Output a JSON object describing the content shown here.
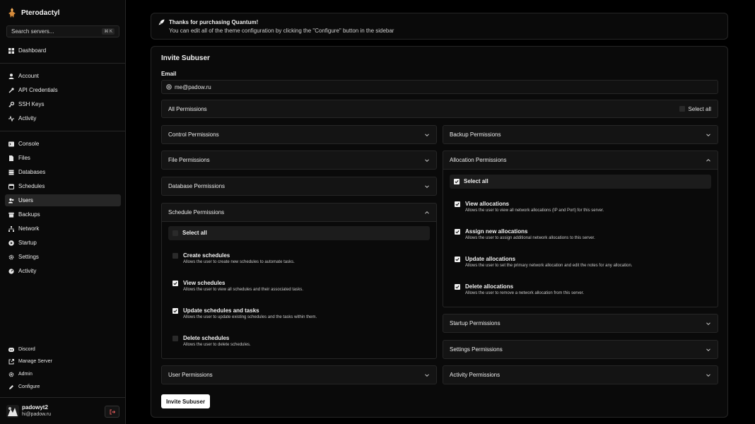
{
  "app": {
    "name": "Pterodactyl"
  },
  "search": {
    "placeholder": "Search servers...",
    "shortcut": "⌘ K"
  },
  "nav": {
    "dashboard": "Dashboard",
    "account": "Account",
    "api_credentials": "API Credentials",
    "ssh_keys": "SSH Keys",
    "activity_account": "Activity",
    "console": "Console",
    "files": "Files",
    "databases": "Databases",
    "schedules": "Schedules",
    "users": "Users",
    "backups": "Backups",
    "network": "Network",
    "startup": "Startup",
    "settings": "Settings",
    "activity_server": "Activity",
    "discord": "Discord",
    "manage_server": "Manage Server",
    "admin": "Admin",
    "configure": "Configure"
  },
  "user": {
    "name": "padowyt2",
    "email": "hi@padow.ru"
  },
  "notice": {
    "title": "Thanks for purchasing Quantum!",
    "body": "You can edit all of the theme configuration by clicking the \"Configure\" button in the sidebar"
  },
  "invite": {
    "title": "Invite Subuser",
    "email_label": "Email",
    "email_value": "me@padow.ru",
    "all_permissions": "All Permissions",
    "select_all": "Select all",
    "submit": "Invite Subuser"
  },
  "sections": {
    "control": "Control Permissions",
    "file": "File Permissions",
    "database": "Database Permissions",
    "schedule": "Schedule Permissions",
    "user": "User Permissions",
    "backup": "Backup Permissions",
    "allocation": "Allocation Permissions",
    "startup": "Startup Permissions",
    "settings": "Settings Permissions",
    "activity": "Activity Permissions"
  },
  "schedule_perms": {
    "select_all": "Select all",
    "items": [
      {
        "title": "Create schedules",
        "desc": "Allows the user to create new schedules to automate tasks.",
        "checked": false
      },
      {
        "title": "View schedules",
        "desc": "Allows the user to view all schedules and their associated tasks.",
        "checked": true
      },
      {
        "title": "Update schedules and tasks",
        "desc": "Allows the user to update existing schedules and the tasks within them.",
        "checked": true
      },
      {
        "title": "Delete schedules",
        "desc": "Allows the user to delete schedules.",
        "checked": false
      }
    ]
  },
  "allocation_perms": {
    "select_all": "Select all",
    "items": [
      {
        "title": "View allocations",
        "desc": "Allows the user to view all network allocations (IP and Port) for this server.",
        "checked": true
      },
      {
        "title": "Assign new allocations",
        "desc": "Allows the user to assign additional network allocations to this server.",
        "checked": true
      },
      {
        "title": "Update allocations",
        "desc": "Allows the user to set the primary network allocation and edit the notes for any allocation.",
        "checked": true
      },
      {
        "title": "Delete allocations",
        "desc": "Allows the user to remove a network allocation from this server.",
        "checked": true
      }
    ]
  },
  "colors": {
    "background": "#000000",
    "surface": "#0a0a0a",
    "border": "#262626",
    "accent": "#ffffff"
  }
}
